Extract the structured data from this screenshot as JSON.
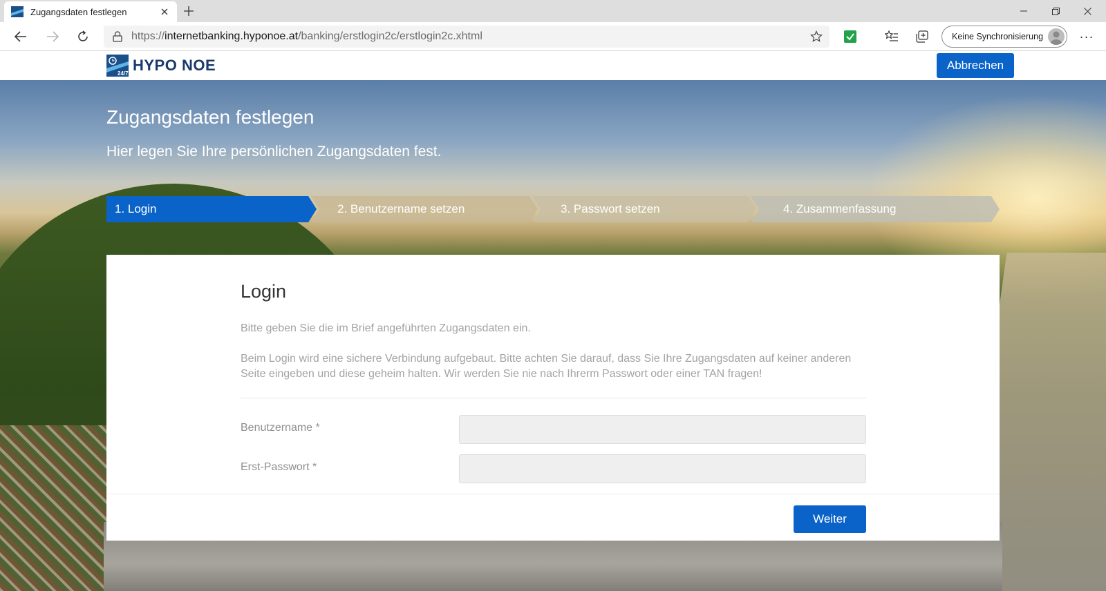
{
  "browser": {
    "tab_title": "Zugangsdaten festlegen",
    "url_scheme": "https://",
    "url_host": "internetbanking.hyponoe.at",
    "url_path": "/banking/erstlogin2c/erstlogin2c.xhtml",
    "sync_label": "Keine Synchronisierung",
    "more_label": "···"
  },
  "site": {
    "logo_text": "HYPO NOE",
    "logo_badge": "24/7",
    "cancel_label": "Abbrechen"
  },
  "hero": {
    "title": "Zugangsdaten festlegen",
    "subtitle": "Hier legen Sie Ihre persönlichen Zugangsdaten fest."
  },
  "steps": [
    {
      "label": "1. Login",
      "active": true
    },
    {
      "label": "2. Benutzername setzen",
      "active": false
    },
    {
      "label": "3. Passwort setzen",
      "active": false
    },
    {
      "label": "4. Zusammenfassung",
      "active": false
    }
  ],
  "card": {
    "title": "Login",
    "intro": "Bitte geben Sie die im Brief angeführten Zugangsdaten ein.",
    "notice": "Beim Login wird eine sichere Verbindung aufgebaut. Bitte achten Sie darauf, dass Sie Ihre Zugangsdaten auf keiner anderen Seite eingeben und diese geheim halten. Wir werden Sie nie nach Ihrerm Passwort oder einer TAN fragen!",
    "username_label": "Benutzername *",
    "username_value": "",
    "password_label": "Erst-Passwort *",
    "password_value": "",
    "next_label": "Weiter"
  },
  "colors": {
    "brand_blue": "#0a63c9",
    "step_inactive": "rgba(190,176,150,0.85)",
    "logo_navy": "#1a3a6b"
  }
}
